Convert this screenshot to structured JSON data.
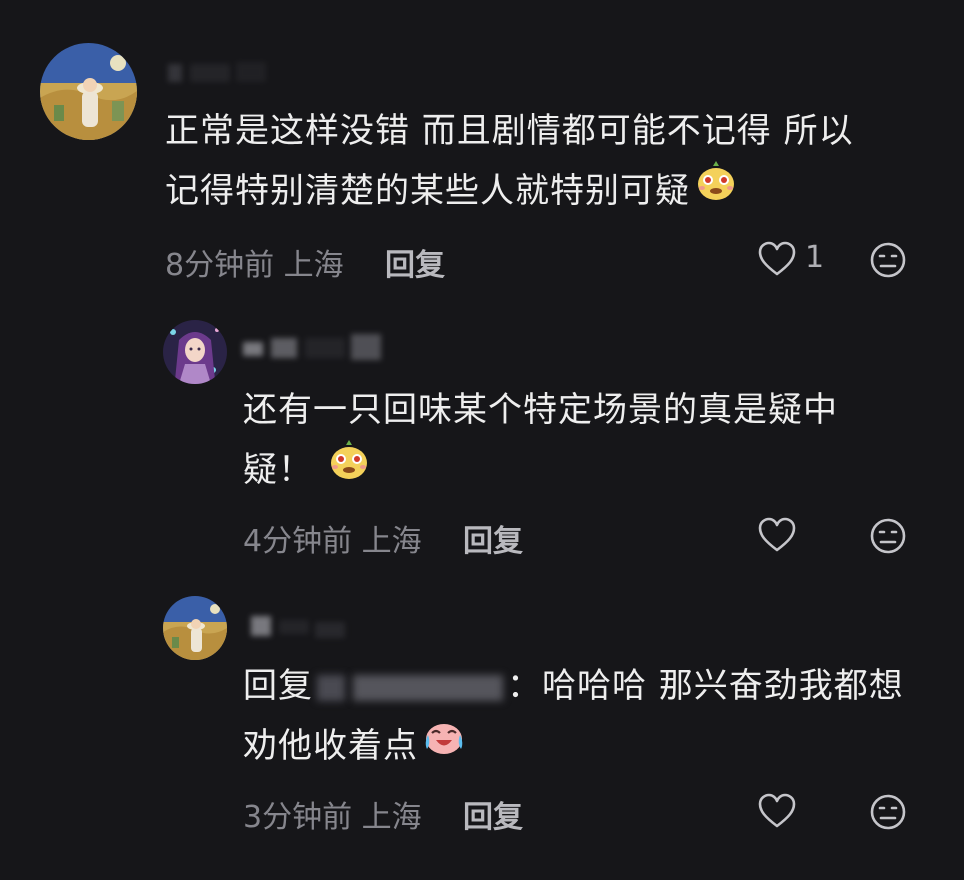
{
  "comments": [
    {
      "text_line1": "正常是这样没错 而且剧情都可能不记得 所以",
      "text_line2": "记得特别清楚的某些人就特别可疑",
      "time": "8分钟前",
      "location": "上海",
      "reply_label": "回复",
      "likes": "1",
      "avatar_icon": "avatar-girl-landscape",
      "emoji_icon": "pear-face-emoji"
    },
    {
      "text_line1": "还有一只回味某个特定场景的真是疑中",
      "text_line2": "疑！",
      "time": "4分钟前",
      "location": "上海",
      "reply_label": "回复",
      "avatar_icon": "avatar-girl-purple-hair",
      "emoji_icon": "pear-face-emoji"
    },
    {
      "reply_prefix": "回复",
      "text_line1_tail": "：哈哈哈 那兴奋劲我都想",
      "text_line2": "劝他收着点",
      "time": "3分钟前",
      "location": "上海",
      "reply_label": "回复",
      "avatar_icon": "avatar-girl-landscape",
      "emoji_icon": "crying-laughing-emoji"
    }
  ],
  "colors": {
    "background": "#161619",
    "text": "#eeeeee",
    "meta": "#86868d",
    "icon": "#c5c5ca"
  }
}
